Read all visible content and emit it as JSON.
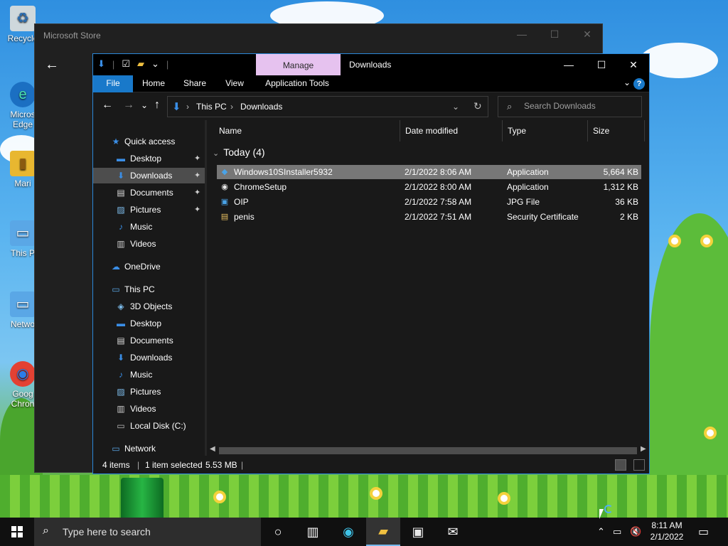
{
  "desktop": {
    "icons": [
      {
        "label": "Recycle",
        "glyph": "♻"
      },
      {
        "label": "Micros Edge",
        "glyph": "e"
      },
      {
        "label": "Mari",
        "glyph": "▮"
      },
      {
        "label": "This P",
        "glyph": "▭"
      },
      {
        "label": "Netwo",
        "glyph": "▭"
      },
      {
        "label": "Goog Chron",
        "glyph": "◉"
      }
    ]
  },
  "store": {
    "title": "Microsoft Store",
    "minimize": "—",
    "maximize": "☐",
    "close": "✕",
    "back": "←"
  },
  "explorer": {
    "manage_tab": "Manage",
    "title": "Downloads",
    "controls": {
      "minimize": "—",
      "maximize": "☐",
      "close": "✕"
    },
    "ribbon": {
      "tabs": [
        {
          "label": "File",
          "key": "file"
        },
        {
          "label": "Home",
          "key": "home"
        },
        {
          "label": "Share",
          "key": "share"
        },
        {
          "label": "View",
          "key": "view"
        },
        {
          "label": "Application Tools",
          "key": "app-tools"
        }
      ],
      "help": "?",
      "collapse": "⌄"
    },
    "nav_buttons": {
      "back": "←",
      "forward": "→",
      "recent": "⌄",
      "up": "↑"
    },
    "address": {
      "crumbs": [
        "This PC",
        "Downloads"
      ],
      "separator": "›",
      "dropdown": "⌄",
      "refresh": "↻"
    },
    "search": {
      "placeholder": "Search Downloads"
    },
    "nav_pane": {
      "quick_access": "Quick access",
      "quick_items": [
        {
          "label": "Desktop",
          "pinned": true,
          "selected": false
        },
        {
          "label": "Downloads",
          "pinned": true,
          "selected": true
        },
        {
          "label": "Documents",
          "pinned": true,
          "selected": false
        },
        {
          "label": "Pictures",
          "pinned": true,
          "selected": false
        },
        {
          "label": "Music",
          "pinned": false,
          "selected": false
        },
        {
          "label": "Videos",
          "pinned": false,
          "selected": false
        }
      ],
      "onedrive": "OneDrive",
      "this_pc": "This PC",
      "pc_items": [
        {
          "label": "3D Objects"
        },
        {
          "label": "Desktop"
        },
        {
          "label": "Documents"
        },
        {
          "label": "Downloads"
        },
        {
          "label": "Music"
        },
        {
          "label": "Pictures"
        },
        {
          "label": "Videos"
        },
        {
          "label": "Local Disk (C:)"
        }
      ],
      "network": "Network",
      "pin_glyph": "📌"
    },
    "columns": [
      "Name",
      "Date modified",
      "Type",
      "Size"
    ],
    "group_label": "Today (4)",
    "files": [
      {
        "name": "Windows10SInstaller5932",
        "date": "2/1/2022 8:06 AM",
        "type": "Application",
        "size": "5,664 KB",
        "selected": true
      },
      {
        "name": "ChromeSetup",
        "date": "2/1/2022 8:00 AM",
        "type": "Application",
        "size": "1,312 KB",
        "selected": false
      },
      {
        "name": "OIP",
        "date": "2/1/2022 7:58 AM",
        "type": "JPG File",
        "size": "36 KB",
        "selected": false
      },
      {
        "name": "penis",
        "date": "2/1/2022 7:51 AM",
        "type": "Security Certificate",
        "size": "2 KB",
        "selected": false
      }
    ],
    "status": {
      "items": "4 items",
      "selected": "1 item selected",
      "size": "5.53 MB",
      "sep": "|"
    }
  },
  "taskbar": {
    "search_placeholder": "Type here to search",
    "clock_time": "8:11 AM",
    "clock_date": "2/1/2022",
    "accent": "#76b9ed"
  },
  "colors": {
    "explorer_bg": "#191919",
    "accent_blue": "#1979ca",
    "manage_tab": "#e6c2ef",
    "selection": "#777777"
  }
}
